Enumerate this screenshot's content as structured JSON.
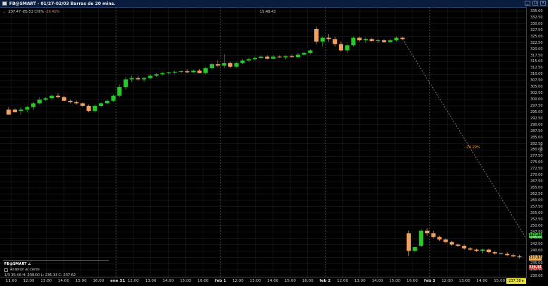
{
  "window": {
    "title": "FB@SMART · 01/27-02/03 Barras de 20 mins.",
    "buttons": [
      "_",
      "□",
      "×"
    ]
  },
  "info_line": {
    "caret": "⌄",
    "price": "237.47",
    "change_prefix": "CHI",
    "change": "-85.53 CHI%",
    "change_pct": "-26.49%"
  },
  "clock": "15:48:43",
  "y_axis": {
    "labels": [
      "335.00",
      "332.50",
      "330.00",
      "327.50",
      "325.00",
      "322.50",
      "320.00",
      "317.50",
      "315.00",
      "312.50",
      "310.00",
      "307.50",
      "305.00",
      "302.50",
      "300.00",
      "297.50",
      "295.00",
      "292.50",
      "290.00",
      "287.50",
      "285.00",
      "282.50",
      "280.00",
      "277.50",
      "275.00",
      "272.50",
      "270.00",
      "267.50",
      "265.00",
      "262.50",
      "260.00",
      "257.50",
      "255.00",
      "252.50",
      "250.00",
      "247.50",
      "245.00",
      "242.50",
      "240.00",
      "237.50",
      "235.00",
      "232.50",
      "230.00"
    ],
    "caption": "Hedg",
    "tags": {
      "green": "247.45",
      "orange": "237.47",
      "red": "236.34"
    }
  },
  "x_axis": {
    "labels": [
      "11:00",
      "12:00",
      "13:00",
      "14:00",
      "15:00",
      "16:00",
      "ene 31",
      "12:00",
      "13:00",
      "14:00",
      "15:00",
      "16:00",
      "feb 1",
      "12:00",
      "13:00",
      "14:00",
      "15:00",
      "16:00",
      "feb 2",
      "12:00",
      "13:00",
      "14:00",
      "15:00",
      "16:00",
      "feb 3",
      "12:00",
      "13:00",
      "14:00",
      "15:00",
      "16:00"
    ],
    "bold": [
      "ene 31",
      "feb 1",
      "feb 2",
      "feb 3"
    ]
  },
  "current_price_box": "237.38 ▸",
  "projection_pct": "-26.29%",
  "panel": {
    "header": "FB@SMART ∠",
    "toggle_label": "Anterior al cierre",
    "foot": "1/3 15:40  H: 238.00  L: 236.34  C: 237.62"
  },
  "colors": {
    "up": "#28c828",
    "down": "#f0a060",
    "bg": "#000000",
    "grid": "#262626"
  },
  "chart_data": {
    "type": "candlestick",
    "ylim": [
      230,
      335
    ],
    "candles": [
      [
        296,
        297,
        295,
        294
      ],
      [
        296,
        296.5,
        295,
        295
      ],
      [
        295.5,
        297,
        294,
        296
      ],
      [
        296,
        297.5,
        295,
        297
      ],
      [
        297,
        299,
        296,
        298.5
      ],
      [
        298.5,
        301,
        298,
        300
      ],
      [
        300,
        301,
        299.5,
        300.5
      ],
      [
        300.5,
        302,
        300,
        301.5
      ],
      [
        301.5,
        302.5,
        300.5,
        301
      ],
      [
        301,
        301.5,
        299.5,
        299.5
      ],
      [
        299.5,
        300,
        298.5,
        299
      ],
      [
        299,
        299.5,
        298,
        298.5
      ],
      [
        298.5,
        299,
        297,
        297.5
      ],
      [
        297.5,
        298,
        295,
        295.5
      ],
      [
        295.5,
        298,
        295,
        297.5
      ],
      [
        297.5,
        299,
        297,
        298.5
      ],
      [
        298.5,
        300,
        298,
        299.5
      ],
      [
        299.5,
        302,
        299,
        301.5
      ],
      [
        301.5,
        306,
        301,
        305
      ],
      [
        305,
        309,
        304,
        308
      ],
      [
        308,
        309.5,
        307,
        308.5
      ],
      [
        308.5,
        309.5,
        307.5,
        308
      ],
      [
        308,
        309,
        307,
        308.5
      ],
      [
        308.5,
        310,
        308,
        309.5
      ],
      [
        309.5,
        310.5,
        309,
        310
      ],
      [
        310,
        311,
        309.5,
        310.5
      ],
      [
        310.5,
        311,
        310,
        310.8
      ],
      [
        310.8,
        311.5,
        310,
        311
      ],
      [
        311,
        311.5,
        310.5,
        311.2
      ],
      [
        311.2,
        312,
        310.5,
        310.8
      ],
      [
        310.8,
        312,
        310.5,
        311.5
      ],
      [
        311.5,
        312,
        310.5,
        310.5
      ],
      [
        310.5,
        313,
        310,
        312.5
      ],
      [
        312.5,
        314.5,
        312,
        314
      ],
      [
        314,
        315.5,
        313,
        313.5
      ],
      [
        313.5,
        318,
        312.5,
        314.5
      ],
      [
        314.5,
        315,
        312.5,
        313
      ],
      [
        313,
        315,
        312.5,
        314.5
      ],
      [
        314.5,
        316,
        314,
        315.5
      ],
      [
        315.5,
        316.5,
        315,
        316
      ],
      [
        316,
        317,
        315.5,
        316.5
      ],
      [
        316.5,
        317.5,
        316,
        317
      ],
      [
        317,
        317.5,
        316,
        316.2
      ],
      [
        316.2,
        317.5,
        316,
        317
      ],
      [
        317,
        317.5,
        316.5,
        316.7
      ],
      [
        316.7,
        317.5,
        316,
        317.2
      ],
      [
        317.2,
        318,
        316.5,
        316.8
      ],
      [
        316.8,
        318.5,
        316.5,
        317.8
      ],
      [
        317.8,
        319,
        317.5,
        318.5
      ],
      [
        318.5,
        320,
        318,
        319.5
      ],
      [
        328,
        329,
        322,
        323
      ],
      [
        323,
        325,
        321,
        324.5
      ],
      [
        324.5,
        326,
        323,
        324
      ],
      [
        324,
        325,
        321,
        322
      ],
      [
        322,
        323,
        319,
        319.5
      ],
      [
        319.5,
        322,
        318.5,
        321.5
      ],
      [
        321.5,
        325,
        321,
        324.5
      ],
      [
        324.5,
        325,
        323,
        323.5
      ],
      [
        323.5,
        324.5,
        322.5,
        324
      ],
      [
        324,
        324.5,
        323,
        323.2
      ],
      [
        323.2,
        324,
        322.5,
        323.5
      ],
      [
        323.5,
        324,
        322.5,
        322.8
      ],
      [
        322.8,
        324,
        322.5,
        323.5
      ],
      [
        323.5,
        325,
        323,
        324.5
      ],
      [
        324.5,
        325,
        323.5,
        324
      ],
      [
        247,
        248,
        238,
        240
      ],
      [
        240,
        241,
        239.5,
        241.5
      ],
      [
        242,
        248.5,
        241.5,
        248
      ],
      [
        248,
        249,
        246,
        247
      ],
      [
        247,
        248,
        245,
        245.5
      ],
      [
        245.5,
        246,
        244,
        244.5
      ],
      [
        244.5,
        245,
        243,
        243.5
      ],
      [
        243.5,
        244,
        242,
        242.5
      ],
      [
        242.5,
        243,
        241.5,
        242
      ],
      [
        242,
        242.5,
        240.5,
        241
      ],
      [
        241,
        241.5,
        240,
        240.5
      ],
      [
        240.5,
        241,
        239.5,
        240
      ],
      [
        240,
        241,
        239,
        240.5
      ],
      [
        240.5,
        241,
        239,
        239.5
      ],
      [
        239.5,
        240,
        238.5,
        239
      ],
      [
        239,
        239.5,
        238.5,
        238.8
      ],
      [
        238.8,
        239.5,
        238,
        238.3
      ],
      [
        238.3,
        239,
        237.5,
        237.8
      ],
      [
        237.8,
        238.5,
        237,
        237.5
      ]
    ]
  }
}
